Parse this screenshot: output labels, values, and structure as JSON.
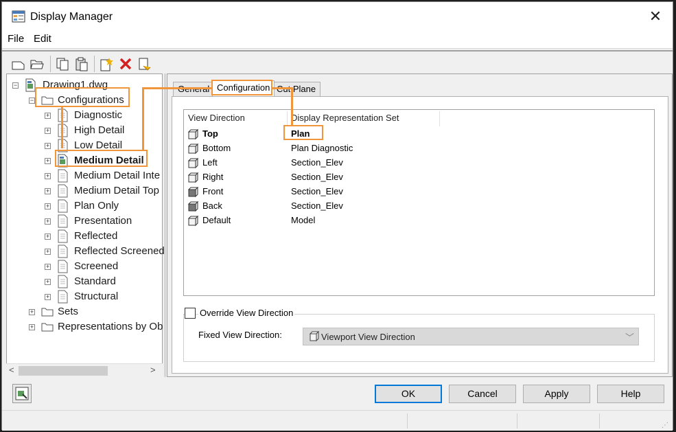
{
  "window": {
    "title": "Display Manager"
  },
  "menu": [
    {
      "label": "File"
    },
    {
      "label": "Edit"
    }
  ],
  "toolbar": {
    "buttons": [
      "new-icon",
      "open-icon",
      "copy-icon",
      "paste-icon",
      "new-item-icon",
      "delete-icon",
      "purge-icon"
    ]
  },
  "tree": {
    "root": "Drawing1.dwg",
    "configurations_label": "Configurations",
    "configurations": [
      {
        "label": "Diagnostic",
        "bold": false
      },
      {
        "label": "High Detail",
        "bold": false
      },
      {
        "label": "Low Detail",
        "bold": false
      },
      {
        "label": "Medium Detail",
        "bold": true
      },
      {
        "label": "Medium Detail Inte",
        "bold": false
      },
      {
        "label": "Medium Detail Top",
        "bold": false
      },
      {
        "label": "Plan Only",
        "bold": false
      },
      {
        "label": "Presentation",
        "bold": false
      },
      {
        "label": "Reflected",
        "bold": false
      },
      {
        "label": "Reflected Screened",
        "bold": false
      },
      {
        "label": "Screened",
        "bold": false
      },
      {
        "label": "Standard",
        "bold": false
      },
      {
        "label": "Structural",
        "bold": false
      }
    ],
    "sets_label": "Sets",
    "reps_label": "Representations by Ob"
  },
  "tabs": [
    {
      "label": "General",
      "active": false
    },
    {
      "label": "Configuration",
      "active": true
    },
    {
      "label": "Cut Plane",
      "active": false
    }
  ],
  "table": {
    "headers": [
      "View Direction",
      "Display Representation Set"
    ],
    "rows": [
      {
        "direction": "Top",
        "set": "Plan",
        "bold": true
      },
      {
        "direction": "Bottom",
        "set": "Plan Diagnostic",
        "bold": false
      },
      {
        "direction": "Left",
        "set": "Section_Elev",
        "bold": false
      },
      {
        "direction": "Right",
        "set": "Section_Elev",
        "bold": false
      },
      {
        "direction": "Front",
        "set": "Section_Elev",
        "bold": false
      },
      {
        "direction": "Back",
        "set": "Section_Elev",
        "bold": false
      },
      {
        "direction": "Default",
        "set": "Model",
        "bold": false
      }
    ]
  },
  "override": {
    "checkbox_label": "Override View Direction",
    "checked": false,
    "fixed_label": "Fixed View Direction:",
    "fixed_value": "Viewport View Direction"
  },
  "buttons": {
    "ok": "OK",
    "cancel": "Cancel",
    "apply": "Apply",
    "help": "Help"
  },
  "colors": {
    "annotation": "#f0953a",
    "default_button_border": "#0078d7"
  }
}
